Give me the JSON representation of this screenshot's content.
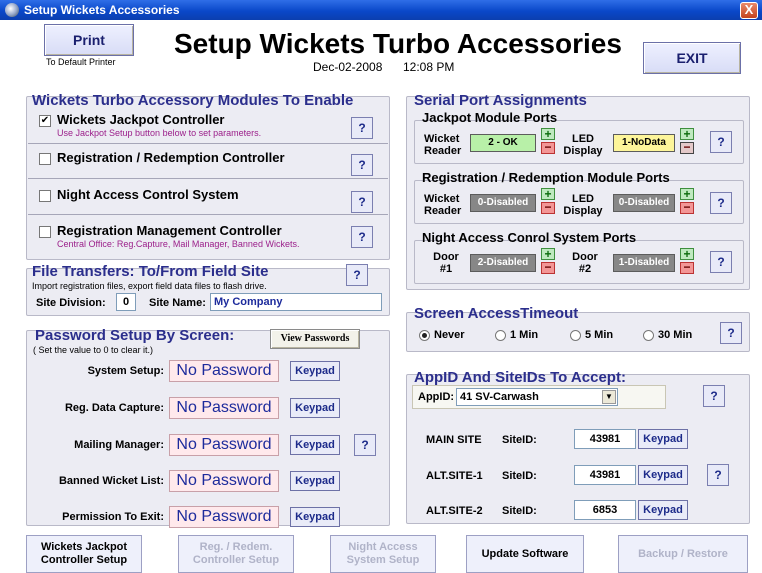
{
  "window": {
    "title": "Setup Wickets Accessories",
    "close_label": "X"
  },
  "header": {
    "print_label": "Print",
    "print_sub": "To Default Printer",
    "title": "Setup Wickets Turbo Accessories",
    "date": "Dec-02-2008",
    "time": "12:08 PM",
    "exit_label": "EXIT"
  },
  "modules": {
    "title": "Wickets Turbo Accessory Modules To Enable",
    "items": [
      {
        "label": "Wickets Jackpot Controller",
        "sub": "Use Jackpot Setup button below to set parameters.",
        "checked": true,
        "check": "✔"
      },
      {
        "label": "Registration / Redemption Controller",
        "sub": "",
        "checked": false,
        "check": ""
      },
      {
        "label": "Night Access Control System",
        "sub": "",
        "checked": false,
        "check": ""
      },
      {
        "label": "Registration Management Controller",
        "sub": "Central Office: Reg.Capture, Mail Manager, Banned Wickets.",
        "checked": false,
        "check": ""
      }
    ],
    "help": "?"
  },
  "file_transfers": {
    "title": "File Transfers: To/From Field Site",
    "sub": "Import registration files, export field data files to flash drive.",
    "division_label": "Site Division:",
    "division_value": "0",
    "name_label": "Site Name:",
    "name_value": "My Company"
  },
  "passwords": {
    "title": "Password Setup By Screen:",
    "sub": "( Set the value to 0 to clear it.)",
    "view_label": "View Passwords",
    "keypad_label": "Keypad",
    "rows": [
      {
        "label": "System Setup:",
        "value": "No Password"
      },
      {
        "label": "Reg. Data Capture:",
        "value": "No Password"
      },
      {
        "label": "Mailing Manager:",
        "value": "No Password"
      },
      {
        "label": "Banned Wicket List:",
        "value": "No Password"
      },
      {
        "label": "Permission To Exit:",
        "value": "No Password"
      }
    ]
  },
  "serial": {
    "title": "Serial Port Assignments",
    "jackpot": {
      "title": "Jackpot Module Ports",
      "left_label": "Wicket Reader",
      "left_value": "2 - OK",
      "left_color": "#b8f0a8",
      "right_label": "LED Display",
      "right_value": "1-NoData",
      "right_color": "#fdf59a"
    },
    "registration": {
      "title": "Registration / Redemption Module Ports",
      "left_label": "Wicket Reader",
      "left_value": "0-Disabled",
      "right_label": "LED Display",
      "right_value": "0-Disabled"
    },
    "night": {
      "title": "Night Access Conrol System Ports",
      "left_label": "Door #1",
      "left_value": "2-Disabled",
      "right_label": "Door #2",
      "right_value": "1-Disabled"
    },
    "plus": "+",
    "minus": "−"
  },
  "timeout": {
    "title": "Screen AccessTimeout",
    "options": [
      "Never",
      "1 Min",
      "5 Min",
      "30 Min"
    ],
    "selected": "Never"
  },
  "appids": {
    "title": "AppID And SiteIDs To Accept:",
    "appid_label": "AppID:",
    "appid_value": "41 SV-Carwash",
    "site_label": "SiteID:",
    "keypad_label": "Keypad",
    "sites": [
      {
        "name": "MAIN SITE",
        "value": "43981"
      },
      {
        "name": "ALT.SITE-1",
        "value": "43981"
      },
      {
        "name": "ALT.SITE-2",
        "value": "6853"
      }
    ]
  },
  "bottom": {
    "b1": "Wickets Jackpot Controller Setup",
    "b2": "Reg. / Redem. Controller Setup",
    "b3": "Night Access System Setup",
    "b4": "Update Software",
    "b5": "Backup / Restore"
  }
}
